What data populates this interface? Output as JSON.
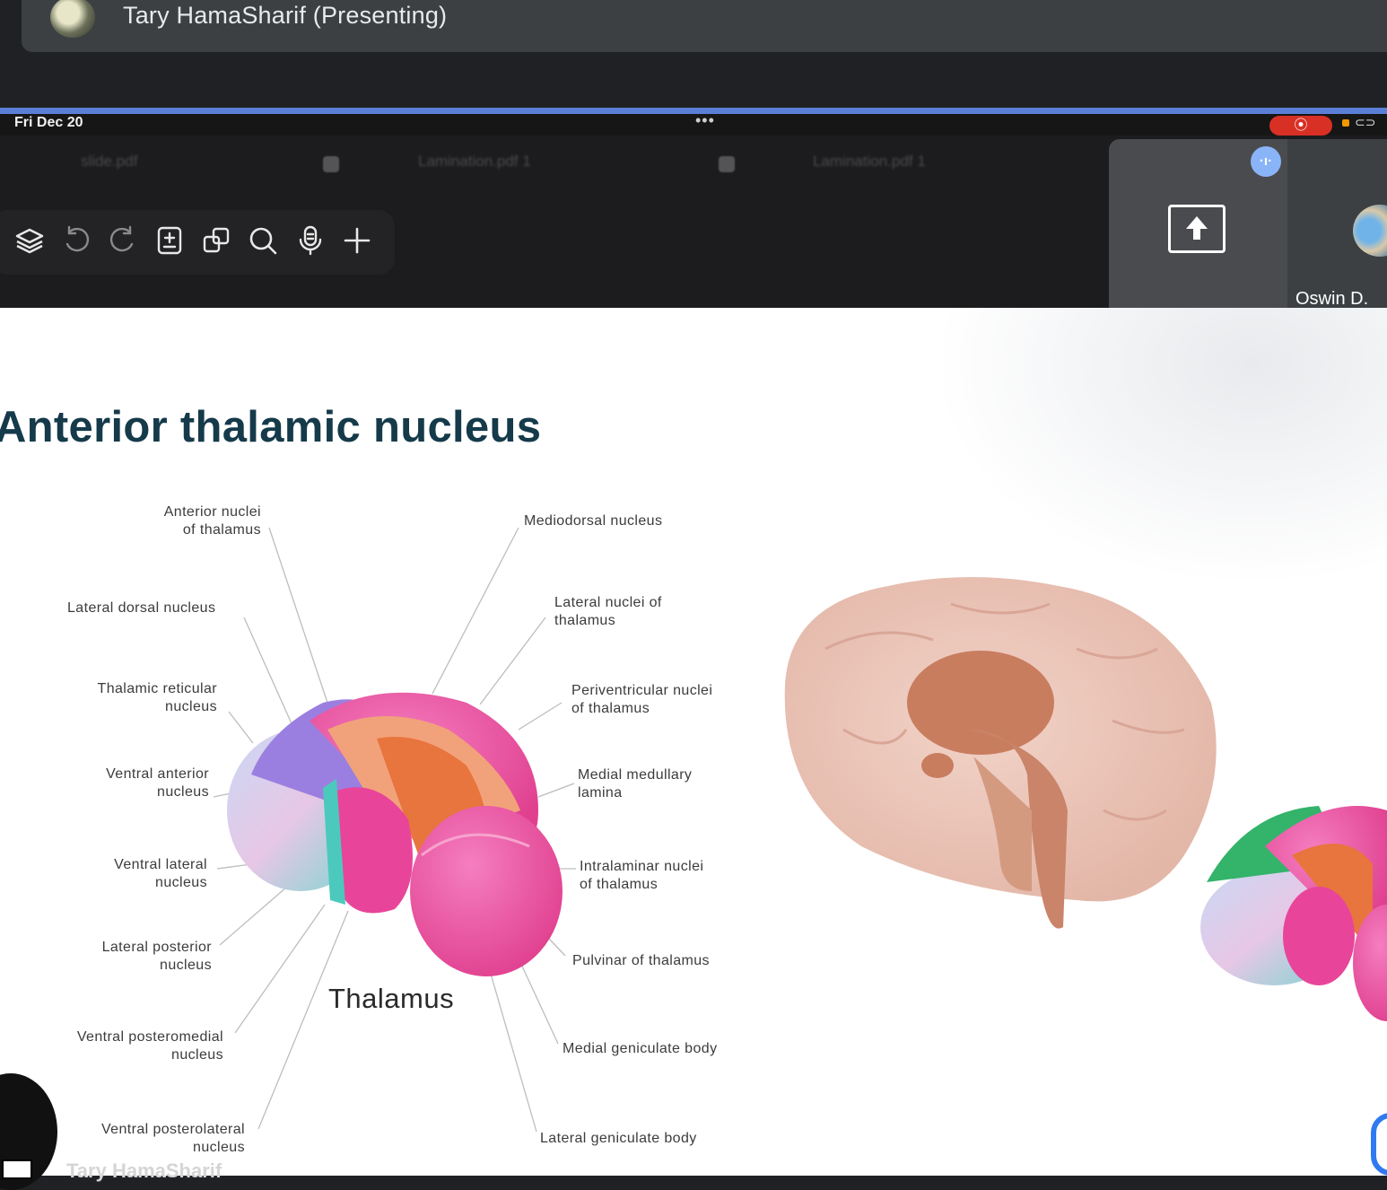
{
  "meet": {
    "presenter_name": "Tary HamaSharif (Presenting)"
  },
  "ipad": {
    "date": "Fri Dec 20",
    "multitask_dots": "•••",
    "tabs": [
      {
        "label": "slide.pdf"
      },
      {
        "label": "Lamination.pdf 1"
      },
      {
        "label": "Lamination.pdf 1"
      }
    ],
    "toolbar_icons": [
      "layers-icon",
      "undo-icon",
      "redo-icon",
      "document-icon",
      "copy-icon",
      "search-icon",
      "microphone-icon",
      "add-icon"
    ]
  },
  "participants": {
    "self_tile_icon": "present-screen-icon",
    "audio_badge_icon": "audio-level-icon",
    "other_name": "Oswin D."
  },
  "slide": {
    "title": "Anterior thalamic nucleus",
    "caption": "Thalamus",
    "left_labels": [
      {
        "text": "Anterior nuclei\nof thalamus"
      },
      {
        "text": "Lateral dorsal nucleus"
      },
      {
        "text": "Thalamic reticular\nnucleus"
      },
      {
        "text": "Ventral anterior\nnucleus"
      },
      {
        "text": "Ventral lateral\nnucleus"
      },
      {
        "text": "Lateral posterior\nnucleus"
      },
      {
        "text": "Ventral posteromedial\nnucleus"
      },
      {
        "text": "Ventral posterolateral\nnucleus"
      }
    ],
    "right_labels": [
      {
        "text": "Mediodorsal nucleus"
      },
      {
        "text": "Lateral nuclei of\nthalamus"
      },
      {
        "text": "Periventricular nuclei\nof thalamus"
      },
      {
        "text": "Medial medullary\nlamina"
      },
      {
        "text": "Intralaminar nuclei\nof thalamus"
      },
      {
        "text": "Pulvinar of thalamus"
      },
      {
        "text": "Medial geniculate body"
      },
      {
        "text": "Lateral geniculate body"
      }
    ]
  },
  "self_view_name": "Tary HamaSharif",
  "colors": {
    "meet_bg": "#202124",
    "title": "#153a4a",
    "pink": "#e8459a",
    "orange": "#e8743e",
    "purple": "#9b7fe0",
    "teal": "#4cc9bd"
  }
}
